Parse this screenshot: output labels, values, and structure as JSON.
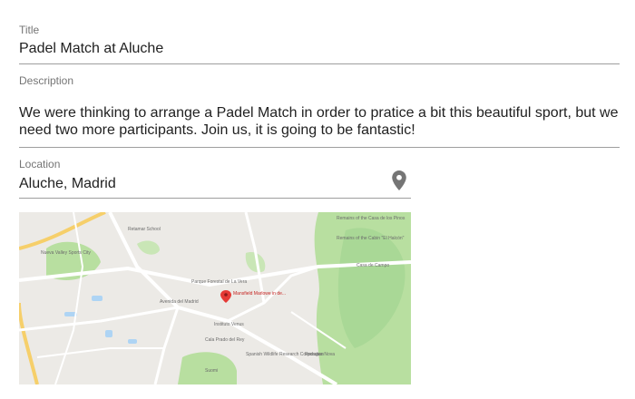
{
  "title_field": {
    "label": "Title",
    "value": "Padel Match at Aluche"
  },
  "description_field": {
    "label": "Description",
    "line1": "We were thinking to arrange a Padel Match in order to pratice a bit this beautiful sport, but we",
    "line2": "need two more participants. Join us, it is going to be fantastic!"
  },
  "location_field": {
    "label": "Location",
    "value": "Aluche, Madrid",
    "icon": "location-pin-icon"
  },
  "map": {
    "marker_label": "Mansfield Marlowe in de...",
    "places": [
      "Retamar School",
      "Nueva Valley Sports City",
      "Parque Forestal de La Vera",
      "Instituto Venus",
      "Avenida del Madrid",
      "Suomi",
      "Cala Prado del Rey",
      "Spanish Wildlife Research Corporation",
      "Rodagas Nova",
      "Remains of the Casa de los Pinos",
      "Remains of the Cabin \"El Halcón\"",
      "Casa de Campo"
    ],
    "colors": {
      "park": "#b8dfa0",
      "park_dark": "#a9d896",
      "road": "#ffffff",
      "highway": "#f6cf6a",
      "water": "#aed4f4",
      "marker": "#e53935"
    }
  }
}
